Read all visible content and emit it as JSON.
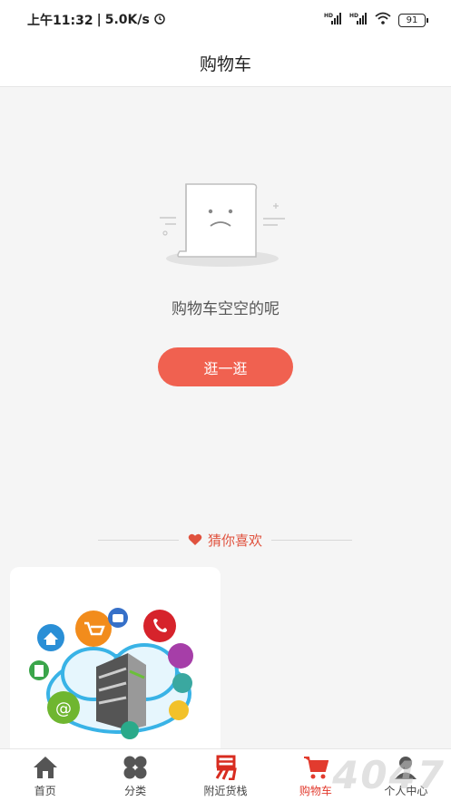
{
  "status_bar": {
    "time": "上午11:32",
    "speed": "5.0K/s",
    "battery": "91"
  },
  "header": {
    "title": "购物车"
  },
  "empty_state": {
    "message": "购物车空空的呢",
    "button_label": "逛一逛"
  },
  "recommend": {
    "title": "猜你喜欢"
  },
  "tabbar": {
    "items": [
      {
        "label": "首页",
        "icon": "home-icon"
      },
      {
        "label": "分类",
        "icon": "category-icon"
      },
      {
        "label": "附近货栈",
        "icon": "nearby-store-icon"
      },
      {
        "label": "购物车",
        "icon": "cart-icon",
        "active": true
      },
      {
        "label": "个人中心",
        "icon": "profile-icon"
      }
    ]
  },
  "watermark": "4047",
  "colors": {
    "accent": "#f06150",
    "active_tab": "#e23b2e",
    "heart": "#e0523e"
  }
}
